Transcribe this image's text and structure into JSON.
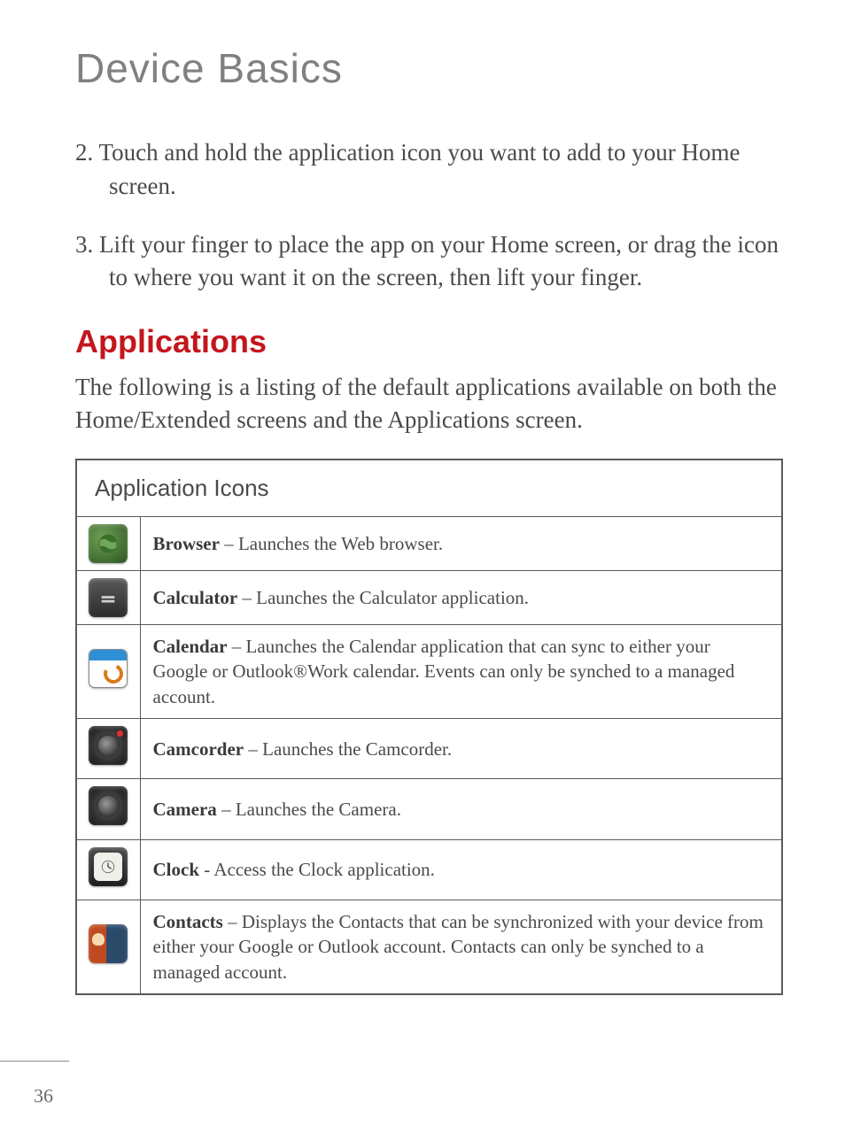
{
  "page_title": "Device Basics",
  "steps": [
    {
      "num": "2.",
      "text": "Touch and hold the application icon you want to add to your Home screen."
    },
    {
      "num": "3.",
      "text": "Lift your finger to place the app on your Home screen, or drag the icon to where you want it on the screen, then lift your finger."
    }
  ],
  "section": {
    "heading": "Applications",
    "intro": "The following is a listing of the default applications available on both the Home/Extended screens and the Applications screen."
  },
  "table": {
    "header": "Application Icons",
    "rows": [
      {
        "icon": "browser-icon",
        "name": "Browser",
        "sep": " – ",
        "desc": "Launches the Web browser."
      },
      {
        "icon": "calculator-icon",
        "name": "Calculator",
        "sep": " – ",
        "desc": "Launches the Calculator application."
      },
      {
        "icon": "calendar-icon",
        "name": "Calendar",
        "sep": " – ",
        "desc": "Launches the Calendar application that can sync to either your Google or Outlook®Work calendar. Events can only be synched to a managed account."
      },
      {
        "icon": "camcorder-icon",
        "name": "Camcorder",
        "sep": " – ",
        "desc": "Launches the Camcorder."
      },
      {
        "icon": "camera-icon",
        "name": "Camera",
        "sep": " – ",
        "desc": "Launches the Camera."
      },
      {
        "icon": "clock-icon",
        "name": "Clock",
        "sep": " - ",
        "desc": "Access the Clock application."
      },
      {
        "icon": "contacts-icon",
        "name": "Contacts",
        "sep": " – ",
        "desc": "Displays the Contacts that can be synchronized with your device from either your Google or Outlook account. Contacts can only be synched to a managed account."
      }
    ]
  },
  "page_number": "36"
}
